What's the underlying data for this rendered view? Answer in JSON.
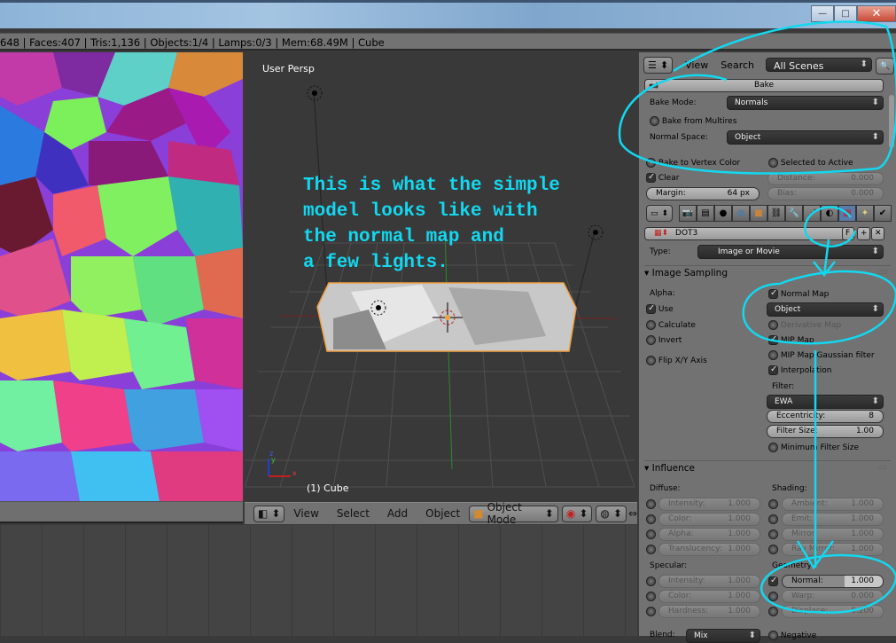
{
  "window": {
    "minimize": "—",
    "maximize": "□",
    "close": "✕"
  },
  "infobar": {
    "stats": "648 | Faces:407 | Tris:1,136 | Objects:1/4 | Lamps:0/3 | Mem:68.49M | Cube"
  },
  "viewport": {
    "view_name": "User Persp",
    "object_label": "(1) Cube",
    "annotation": "This is what the simple\nmodel looks like with\nthe normal map and\na few lights.",
    "axis": {
      "x": "x",
      "y": "y",
      "z": "z"
    }
  },
  "viewport_header": {
    "menus": [
      "View",
      "Select",
      "Add",
      "Object"
    ],
    "mode": "Object Mode"
  },
  "outliner": {
    "menus": [
      "View",
      "Search"
    ],
    "scene_select": "All Scenes"
  },
  "bake": {
    "title": "Bake",
    "bake_mode_label": "Bake Mode:",
    "bake_mode": "Normals",
    "bake_from_multires": "Bake from Multires",
    "normal_space_label": "Normal Space:",
    "normal_space": "Object",
    "bake_to_vertex_color": "Bake to Vertex Color",
    "selected_to_active": "Selected to Active",
    "clear": "Clear",
    "margin_label": "Margin:",
    "margin": "64 px",
    "distance_label": "Distance:",
    "distance": "0.000",
    "bias_label": "Bias:",
    "bias": "0.000"
  },
  "texture": {
    "name": "DOT3",
    "fake_user": "F",
    "type_label": "Type:",
    "type": "Image or Movie"
  },
  "image_sampling": {
    "title": "Image Sampling",
    "alpha_label": "Alpha:",
    "use": "Use",
    "calculate": "Calculate",
    "invert": "Invert",
    "flip": "Flip X/Y Axis",
    "normal_map": "Normal Map",
    "normal_space": "Object",
    "derivative_map": "Derivative Map",
    "mip_map": "MIP Map",
    "mip_gauss": "MIP Map Gaussian filter",
    "interpolation": "Interpolation",
    "filter_label": "Filter:",
    "filter": "EWA",
    "eccentricity_label": "Eccentricity:",
    "eccentricity": "8",
    "filter_size_label": "Filter Size:",
    "filter_size": "1.00",
    "min_filter": "Minimum Filter Size"
  },
  "influence": {
    "title": "Influence",
    "diffuse_label": "Diffuse:",
    "diffuse": [
      {
        "label": "Intensity:",
        "value": "1.000"
      },
      {
        "label": "Color:",
        "value": "1.000"
      },
      {
        "label": "Alpha:",
        "value": "1.000"
      },
      {
        "label": "Translucency:",
        "value": "1.000"
      }
    ],
    "shading_label": "Shading:",
    "shading": [
      {
        "label": "Ambient:",
        "value": "1.000"
      },
      {
        "label": "Emit:",
        "value": "1.000"
      },
      {
        "label": "Mirror:",
        "value": "1.000"
      },
      {
        "label": "Ray Mirror:",
        "value": "1.000"
      }
    ],
    "specular_label": "Specular:",
    "specular": [
      {
        "label": "Intensity:",
        "value": "1.000"
      },
      {
        "label": "Color:",
        "value": "1.000"
      },
      {
        "label": "Hardness:",
        "value": "1.000"
      }
    ],
    "geometry_label": "Geometry:",
    "geometry": [
      {
        "label": "Normal:",
        "value": "1.000"
      },
      {
        "label": "Warp:",
        "value": "0.000"
      },
      {
        "label": "Displace:",
        "value": "0.200"
      }
    ],
    "blend_label": "Blend:",
    "blend": "Mix",
    "negative": "Negative"
  },
  "colors": {
    "annotation": "#12d8f0",
    "selection": "#f0a040",
    "active_tab": "#5a7aa8"
  }
}
